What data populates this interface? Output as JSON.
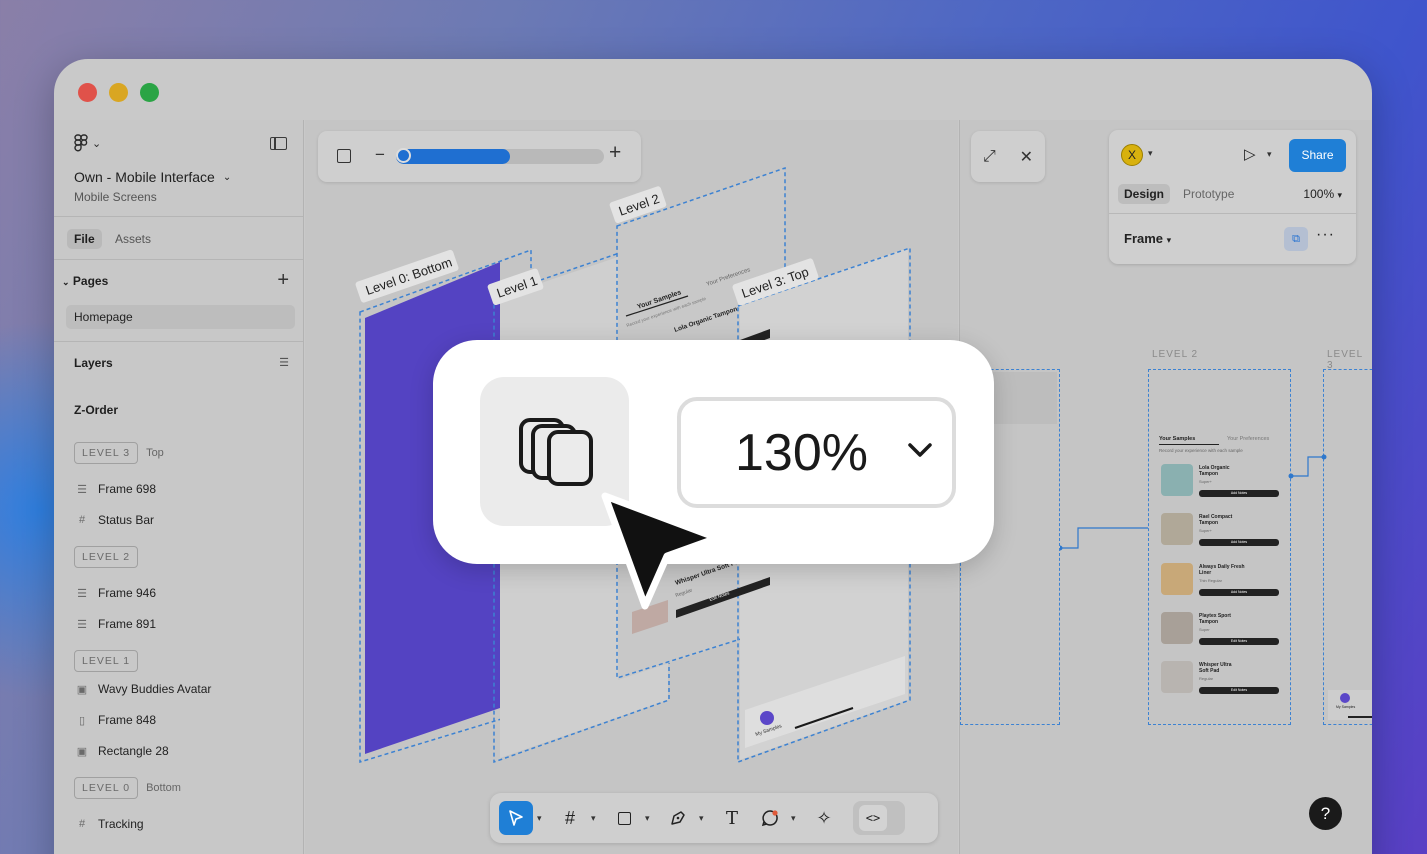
{
  "window": {
    "controls": [
      "close",
      "minimize",
      "maximize"
    ]
  },
  "sidebar": {
    "project_title": "Own - Mobile Interface",
    "project_subtitle": "Mobile Screens",
    "tabs": [
      {
        "label": "File",
        "active": true
      },
      {
        "label": "Assets",
        "active": false
      }
    ],
    "pages_heading": "Pages",
    "pages": [
      "Homepage"
    ],
    "layers_heading": "Layers",
    "zorder_heading": "Z-Order",
    "levels": [
      {
        "badge": "LEVEL 3",
        "tag": "Top",
        "layers": [
          {
            "name": "Frame 698",
            "icon": "frame-icon"
          },
          {
            "name": "Status Bar",
            "icon": "hash-icon"
          }
        ]
      },
      {
        "badge": "LEVEL 2",
        "tag": "",
        "layers": [
          {
            "name": "Frame 946",
            "icon": "frame-icon"
          },
          {
            "name": "Frame 891",
            "icon": "frame-icon"
          }
        ]
      },
      {
        "badge": "LEVEL 1",
        "tag": "",
        "layers": [
          {
            "name": "Wavy Buddies Avatar",
            "icon": "image-icon"
          },
          {
            "name": "Frame 848",
            "icon": "columns-icon"
          },
          {
            "name": "Rectangle 28",
            "icon": "image-icon"
          }
        ]
      },
      {
        "badge": "LEVEL 0",
        "tag": "Bottom",
        "layers": [
          {
            "name": "Tracking",
            "icon": "hash-icon"
          }
        ]
      }
    ]
  },
  "canvas": {
    "zoom_slider_level": 0.55,
    "stack_labels": [
      "Level 0: Bottom",
      "Level 1",
      "Level 2",
      "Level 3: Top"
    ],
    "stack_texts": {
      "your_samples": "Your Samples",
      "your_preferences": "Your Preferences",
      "record_hint": "Record your experience with each sample",
      "item1": "Lola Organic Tampon",
      "item_last": "Whisper Ultra Soft Pad",
      "item_last_sub": "Regular",
      "edit_notes": "Edit Notes",
      "tab_my_samples": "My Samples"
    }
  },
  "toolbar": {
    "tools": [
      "move",
      "frame",
      "rectangle",
      "pen",
      "text",
      "comment",
      "ai"
    ],
    "active": "move"
  },
  "right_panel": {
    "avatar_initial": "X",
    "share_label": "Share",
    "tabs": [
      {
        "label": "Design",
        "active": true
      },
      {
        "label": "Prototype",
        "active": false
      }
    ],
    "zoom": "100%",
    "frame_label": "Frame",
    "level_labels": [
      "LEVEL 2",
      "LEVEL 3"
    ],
    "phone": {
      "tab_a": "Your Samples",
      "tab_b": "Your Preferences",
      "hint": "Record your experience with each sample",
      "items": [
        {
          "title": "Lola Organic Tampon",
          "sub": "Super+",
          "button": "Add Notes"
        },
        {
          "title": "Rael Compact Tampon",
          "sub": "Super+",
          "button": "Add Notes"
        },
        {
          "title": "Always Daily Fresh Liner",
          "sub": "Thin Regular",
          "button": "Add Notes"
        },
        {
          "title": "Playtex Sport Tampon",
          "sub": "Super",
          "button": "Edit Notes"
        },
        {
          "title": "Whisper Ultra Soft Pad",
          "sub": "Regular",
          "button": "Edit Notes"
        }
      ],
      "nav_label": "My Samples"
    }
  },
  "overlay": {
    "zoom_value": "130%"
  },
  "colors": {
    "accent": "#1f7fd6",
    "level0": "#5b47c8",
    "dashed": "#3c82d2"
  }
}
